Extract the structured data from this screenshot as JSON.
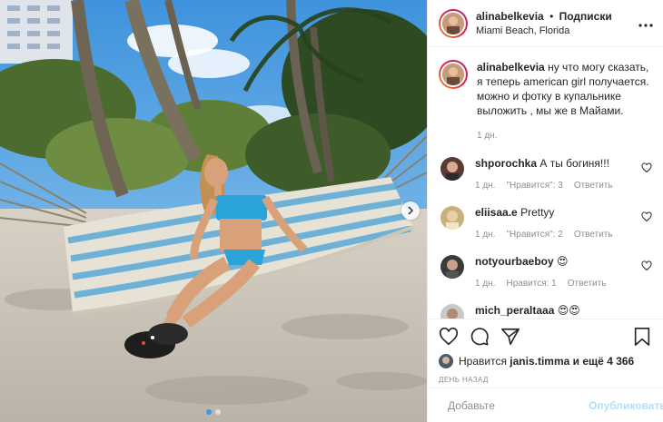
{
  "post": {
    "author": "alinabelkevia",
    "follow_separator": "•",
    "follow_label": "Подписки",
    "location": "Miami Beach, Florida"
  },
  "caption": {
    "username": "alinabelkevia",
    "text": "ну что могу сказать, я теперь american girl получается. можно и фотку в купальнике выложить , мы же в Майами.",
    "time": "1 дн."
  },
  "comments": [
    {
      "username": "shporochka",
      "text": "А ты богиня!!!",
      "time": "1 дн.",
      "likes": "\"Нравится\": 3",
      "reply": "Ответить"
    },
    {
      "username": "eliisaa.e",
      "text": "Prettyy",
      "time": "1 дн.",
      "likes": "\"Нравится\": 2",
      "reply": "Ответить"
    },
    {
      "username": "notyourbaeboy",
      "text": "😍",
      "time": "1 дн.",
      "likes": "Нравится: 1",
      "reply": "Ответить"
    },
    {
      "username": "mich_peraltaaa",
      "text": "😍😍",
      "time": "",
      "likes": "",
      "reply": ""
    }
  ],
  "likes": {
    "prefix": "Нравится",
    "user": "janis.timma",
    "suffix": "и ещё 4 366"
  },
  "date_label": "ДЕНЬ НАЗАД",
  "add_comment": {
    "placeholder": "Добавьте",
    "publish_label": "Опубликовать"
  },
  "icons": {
    "more": "more-icon",
    "like": "heart-icon",
    "comment": "comment-icon",
    "share": "share-icon",
    "save": "bookmark-icon",
    "emoji": "emoji-icon",
    "next": "chevron-right-icon"
  },
  "colors": {
    "accent": "#3897f0",
    "text": "#262626",
    "muted": "#8e8e8e",
    "publish_disabled": "#b2dffc",
    "border": "#efefef"
  },
  "carousel": {
    "count": 2,
    "active_index": 0
  }
}
